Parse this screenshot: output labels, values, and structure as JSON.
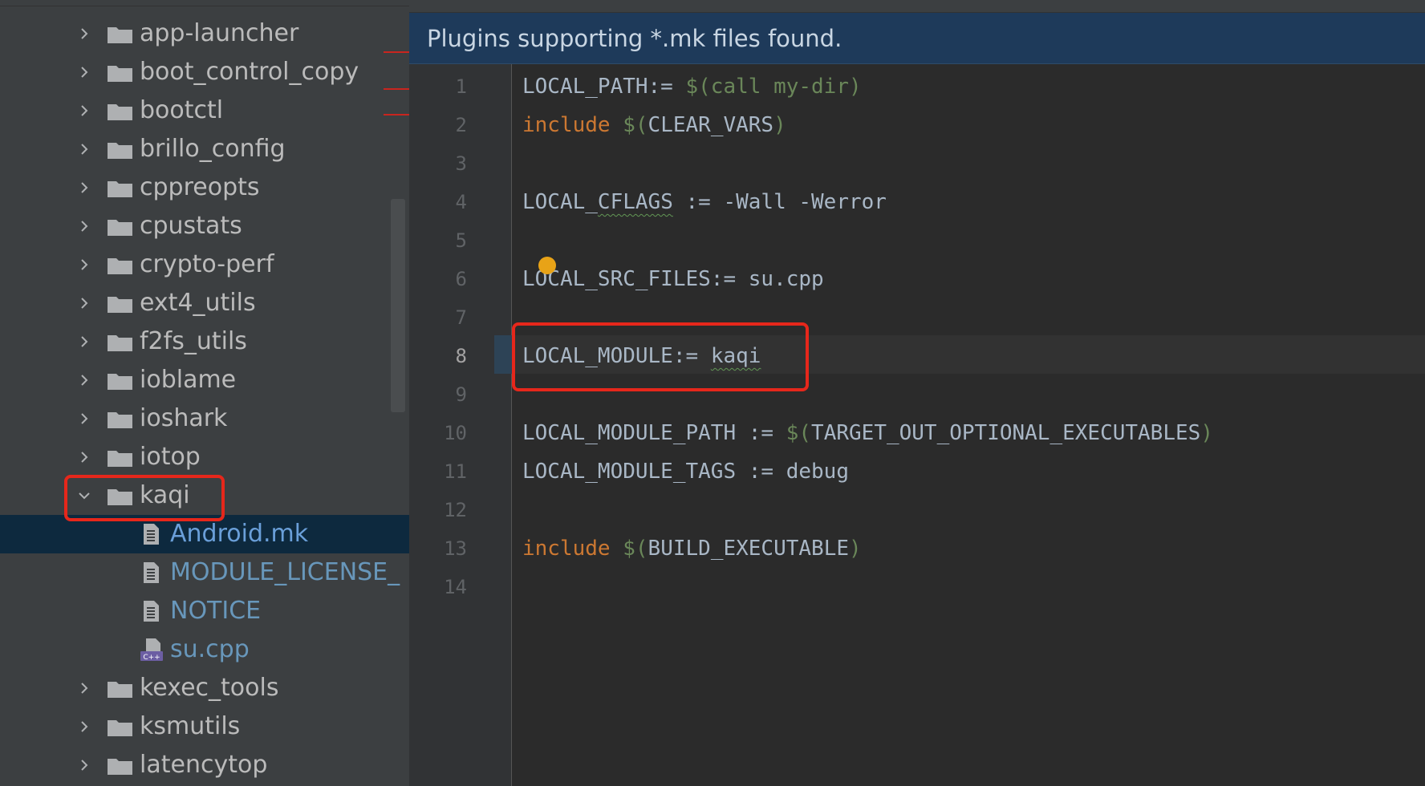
{
  "project_tree": {
    "items": [
      {
        "label": "app-launcher",
        "type": "folder",
        "expanded": false
      },
      {
        "label": "boot_control_copy",
        "type": "folder",
        "expanded": false
      },
      {
        "label": "bootctl",
        "type": "folder",
        "expanded": false
      },
      {
        "label": "brillo_config",
        "type": "folder",
        "expanded": false
      },
      {
        "label": "cppreopts",
        "type": "folder",
        "expanded": false
      },
      {
        "label": "cpustats",
        "type": "folder",
        "expanded": false
      },
      {
        "label": "crypto-perf",
        "type": "folder",
        "expanded": false
      },
      {
        "label": "ext4_utils",
        "type": "folder",
        "expanded": false
      },
      {
        "label": "f2fs_utils",
        "type": "folder",
        "expanded": false
      },
      {
        "label": "ioblame",
        "type": "folder",
        "expanded": false
      },
      {
        "label": "ioshark",
        "type": "folder",
        "expanded": false
      },
      {
        "label": "iotop",
        "type": "folder",
        "expanded": false
      },
      {
        "label": "kaqi",
        "type": "folder",
        "expanded": true
      },
      {
        "label": "Android.mk",
        "type": "file",
        "selected": true
      },
      {
        "label": "MODULE_LICENSE_",
        "type": "file"
      },
      {
        "label": "NOTICE",
        "type": "file"
      },
      {
        "label": "su.cpp",
        "type": "cpp-file"
      },
      {
        "label": "kexec_tools",
        "type": "folder",
        "expanded": false
      },
      {
        "label": "ksmutils",
        "type": "folder",
        "expanded": false
      },
      {
        "label": "latencytop",
        "type": "folder",
        "expanded": false
      }
    ]
  },
  "editor": {
    "banner": "Plugins supporting *.mk files found.",
    "current_line": 8,
    "line_numbers": [
      "1",
      "2",
      "3",
      "4",
      "5",
      "6",
      "7",
      "8",
      "9",
      "10",
      "11",
      "12",
      "13",
      "14"
    ],
    "lines": {
      "l1": {
        "a": "LOCAL_PATH:= ",
        "b": "$(call my-dir)"
      },
      "l2": {
        "a": "include",
        "b": " $(",
        "c": "CLEAR_VARS",
        "d": ")"
      },
      "l4": {
        "a": "LOCAL_",
        "b": "CFLAGS",
        "c": " := -Wall -Werror"
      },
      "l6": {
        "a": "LOCAL_SRC_FILES:= su.cpp"
      },
      "l8": {
        "a": "LOCAL_MODULE:= ",
        "b": "kaqi"
      },
      "l10": {
        "a": "LOCAL_MODULE_PATH := ",
        "b": "$(",
        "c": "TARGET_OUT_OPTIONAL_EXECUTABLES",
        "d": ")"
      },
      "l11": {
        "a": "LOCAL_MODULE_TAGS := debug"
      },
      "l13": {
        "a": "include",
        "b": " $(",
        "c": "BUILD_EXECUTABLE",
        "d": ")"
      }
    }
  },
  "colors": {
    "tree_bg": "#3c3f41",
    "selection": "#0d293e",
    "editor_bg": "#2b2b2b",
    "banner_bg": "#1e3a5a",
    "keyword": "#cc7832",
    "string": "#6a8759",
    "annotation_red": "#e6271b"
  }
}
